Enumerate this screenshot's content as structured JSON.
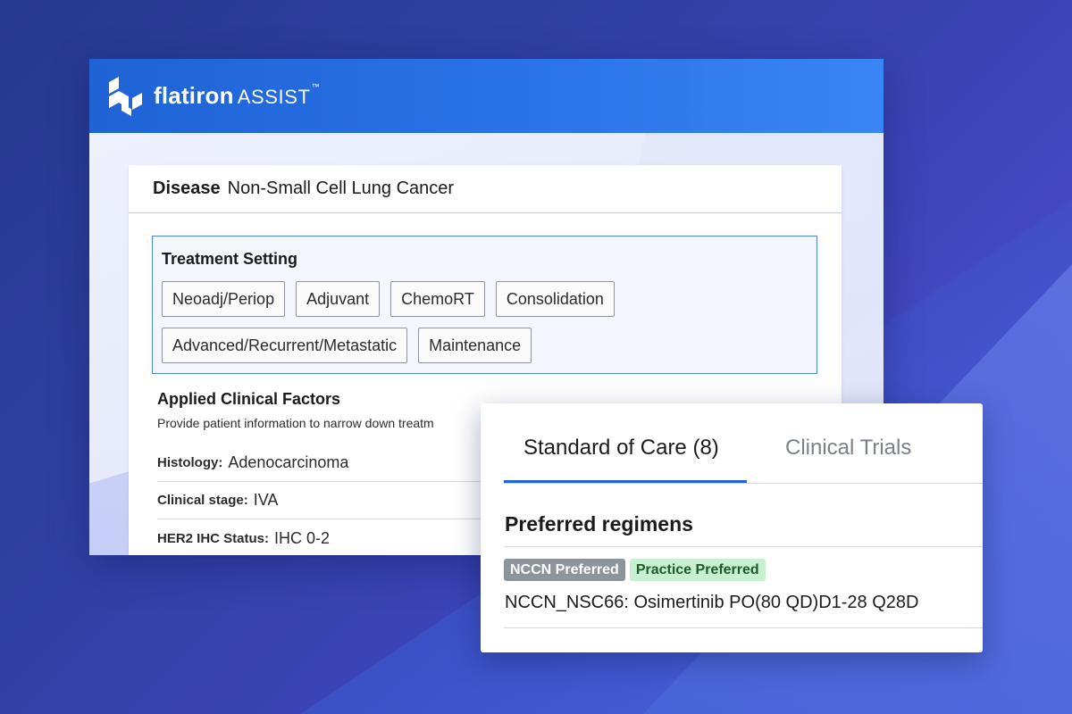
{
  "app": {
    "brand": "flatiron",
    "product": "ASSIST",
    "trademark": "™"
  },
  "disease": {
    "label": "Disease",
    "value": "Non-Small Cell Lung Cancer"
  },
  "treatment_setting": {
    "title": "Treatment Setting",
    "options_row1": [
      "Neoadj/Periop",
      "Adjuvant",
      "ChemoRT",
      "Consolidation"
    ],
    "options_row2": [
      "Advanced/Recurrent/Metastatic",
      "Maintenance"
    ]
  },
  "clinical_factors": {
    "title": "Applied Clinical Factors",
    "description": "Provide patient information to narrow down treatm",
    "rows": [
      {
        "label": "Histology:",
        "value": "Adenocarcinoma"
      },
      {
        "label": "Clinical stage:",
        "value": "IVA"
      },
      {
        "label": "HER2 IHC Status:",
        "value": "IHC 0-2"
      }
    ]
  },
  "results": {
    "tabs": [
      {
        "label": "Standard of Care (8)",
        "active": true
      },
      {
        "label": "Clinical Trials",
        "active": false
      }
    ],
    "section_title": "Preferred regimens",
    "badges": [
      {
        "label": "NCCN Preferred",
        "color": "#8e949b"
      },
      {
        "label": "Practice Preferred",
        "color": "#c8efcf"
      }
    ],
    "regimen": "NCCN_NSC66: Osimertinib PO(80 QD)D1-28 Q28D"
  },
  "colors": {
    "header_blue": "#1f63d5",
    "accent_border": "#4d82e0",
    "tab_underline": "#1f63d5"
  }
}
